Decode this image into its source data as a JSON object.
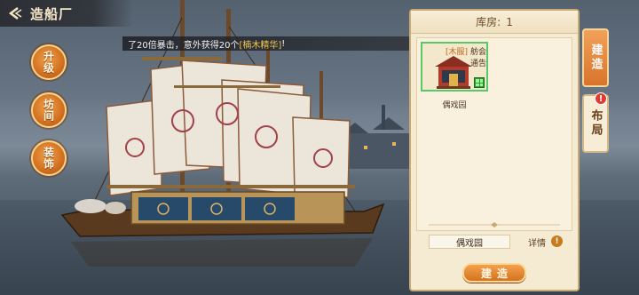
{
  "header": {
    "title": "造船厂"
  },
  "left_menu": [
    {
      "label": "升级"
    },
    {
      "label": "坊间"
    },
    {
      "label": "装饰"
    }
  ],
  "notice": {
    "prefix": "了20倍暴击，意外获得20个",
    "highlight": "[楠木精华]",
    "suffix": "!"
  },
  "warehouse": {
    "title": "库房:",
    "count": "1",
    "items": [
      {
        "tag": "[木服]",
        "tag_text": "舫会通告",
        "name": "偶戏园",
        "count_icon": "grid-icon"
      }
    ]
  },
  "selected": {
    "name": "偶戏园",
    "detail_label": "详情",
    "detail_icon": "!"
  },
  "build_button": "建造",
  "side_tabs": [
    {
      "label": "建造",
      "active": true
    },
    {
      "label": "布局",
      "active": false,
      "badge": "!"
    }
  ],
  "colors": {
    "accent": "#d8742a",
    "panel_bg": "#f5ead2",
    "selected_border": "#59c86b",
    "badge": "#e23a32",
    "highlight_text": "#f4c84a"
  }
}
